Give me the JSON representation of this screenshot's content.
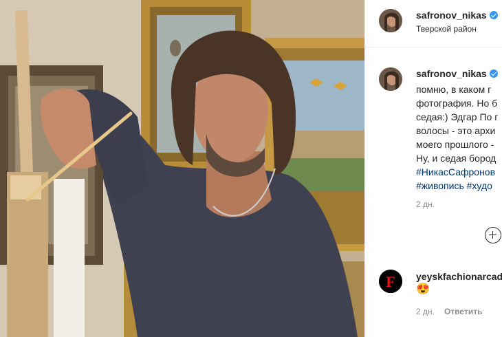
{
  "post": {
    "author": {
      "username": "safronov_nikas",
      "location": "Тверской район",
      "verified": true
    },
    "caption": {
      "lines": [
        "помню, в каком г",
        "фотография. Но б",
        "седая:) Эдгар По г",
        "волосы - это архи",
        "моего прошлого -",
        "Ну, и седая бород"
      ],
      "hashtags_line1": "#НикасСафронов",
      "hashtags_line2": "#живопись #худо"
    },
    "time_ago": "2 дн.",
    "add_comment_icon": "plus-circle-icon"
  },
  "comments": [
    {
      "username": "yeyskfachionarcad",
      "text": "😍",
      "time_ago": "2 дн.",
      "reply_label": "Ответить",
      "avatar_letter": "F",
      "avatar_color": "#e1121a"
    }
  ],
  "colors": {
    "link": "#00376b",
    "muted": "#8e8e8e",
    "verified": "#3897f0"
  }
}
